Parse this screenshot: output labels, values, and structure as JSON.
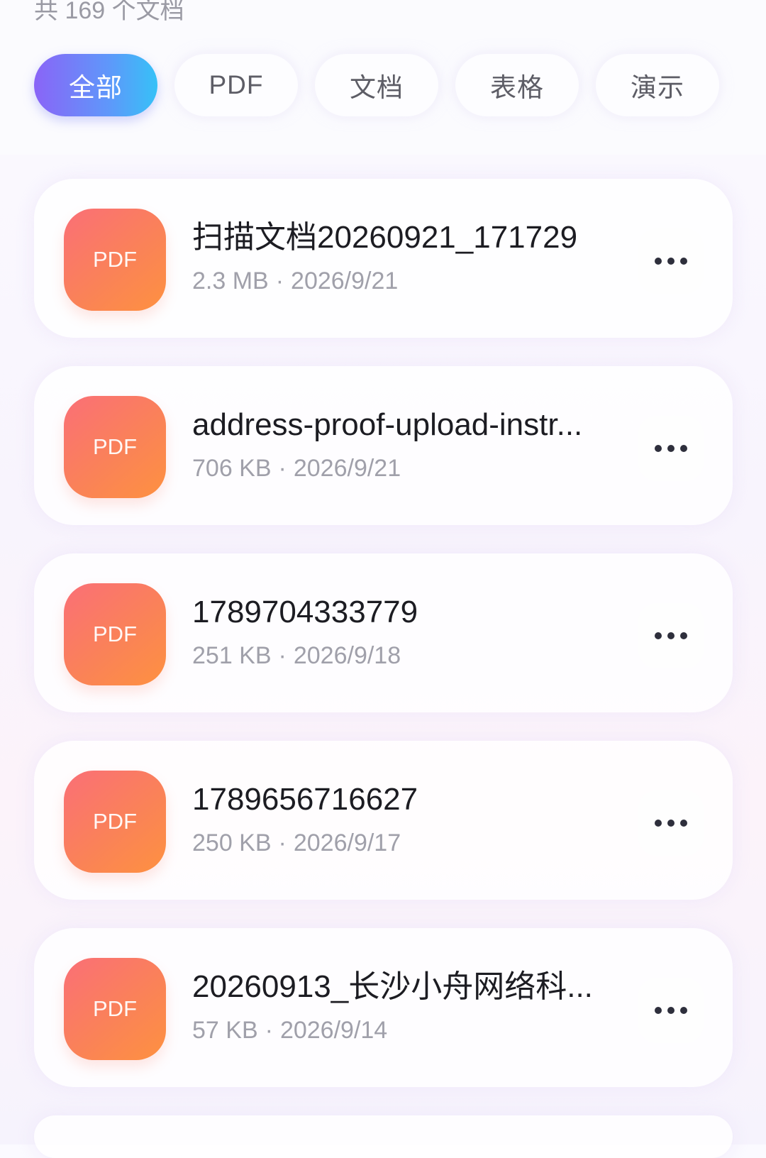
{
  "summary": {
    "count_text": "共 169 个文档"
  },
  "tabs": [
    {
      "label": "全部",
      "active": true
    },
    {
      "label": "PDF",
      "active": false
    },
    {
      "label": "文档",
      "active": false
    },
    {
      "label": "表格",
      "active": false
    },
    {
      "label": "演示",
      "active": false
    }
  ],
  "files": [
    {
      "type": "PDF",
      "name": "扫描文档20260921_171729",
      "size": "2.3 MB",
      "date": "2026/9/21"
    },
    {
      "type": "PDF",
      "name": "address-proof-upload-instr...",
      "size": "706 KB",
      "date": "2026/9/21"
    },
    {
      "type": "PDF",
      "name": "1789704333779",
      "size": "251 KB",
      "date": "2026/9/18"
    },
    {
      "type": "PDF",
      "name": "1789656716627",
      "size": "250 KB",
      "date": "2026/9/17"
    },
    {
      "type": "PDF",
      "name": "20260913_长沙小舟网络科...",
      "size": "57 KB",
      "date": "2026/9/14"
    }
  ],
  "meta_separator": "·",
  "icons": {
    "more": "more-horizontal-icon"
  },
  "colors": {
    "accent_gradient_start": "#8a64f7",
    "accent_gradient_end": "#36c1f7",
    "pdf_icon_start": "#fa6f77",
    "pdf_icon_end": "#fe9140"
  }
}
